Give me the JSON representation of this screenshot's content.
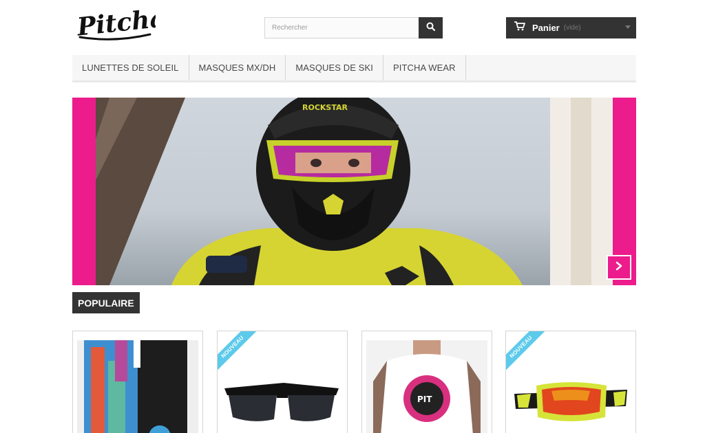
{
  "header": {
    "logo_text": "Pitcha.",
    "search": {
      "placeholder": "Rechercher"
    },
    "cart": {
      "label": "Panier",
      "status": "(vide)"
    }
  },
  "menu": {
    "items": [
      {
        "label": "LUNETTES DE SOLEIL"
      },
      {
        "label": "MASQUES MX/DH"
      },
      {
        "label": "MASQUES DE SKI"
      },
      {
        "label": "PITCHA WEAR"
      }
    ]
  },
  "slider": {
    "slide_alt": "Rider wearing pink and yellow goggles and a Rockstar helmet",
    "colors": {
      "frame": "#ec1c8c"
    }
  },
  "section": {
    "title": "POPULAIRE"
  },
  "products": [
    {
      "badge": ""
    },
    {
      "badge": "NOUVEAU"
    },
    {
      "badge": ""
    },
    {
      "badge": "NOUVEAU"
    }
  ],
  "colors": {
    "dark": "#333333",
    "accent_pink": "#ec1c8c",
    "ribbon_blue": "#5ccaeb",
    "menu_bg": "#f6f6f6"
  }
}
